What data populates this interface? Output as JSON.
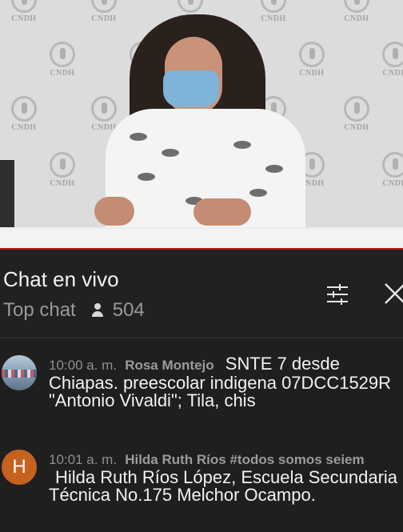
{
  "video": {
    "backdrop_logo_text": "CNDH"
  },
  "chat": {
    "title": "Chat en vivo",
    "mode_label": "Top chat",
    "viewer_count": "504",
    "icons": {
      "filter": "tune-icon",
      "close": "close-icon",
      "viewers": "person-icon"
    }
  },
  "messages": [
    {
      "avatar": "photo",
      "time": "10:00 a. m.",
      "author": "Rosa Montejo",
      "text": "SNTE 7 desde Chiapas. preescolar indigena 07DCC1529R \"Antonio Vivaldi\"; Tila, chis"
    },
    {
      "avatar": "H",
      "avatar_color": "#c5621f",
      "time": "10:01 a. m.",
      "author": "Hilda Ruth Ríos #todos somos seiem",
      "text": "Hilda Ruth Ríos López, Escuela Secundaria Técnica No.175 Melchor Ocampo."
    }
  ]
}
